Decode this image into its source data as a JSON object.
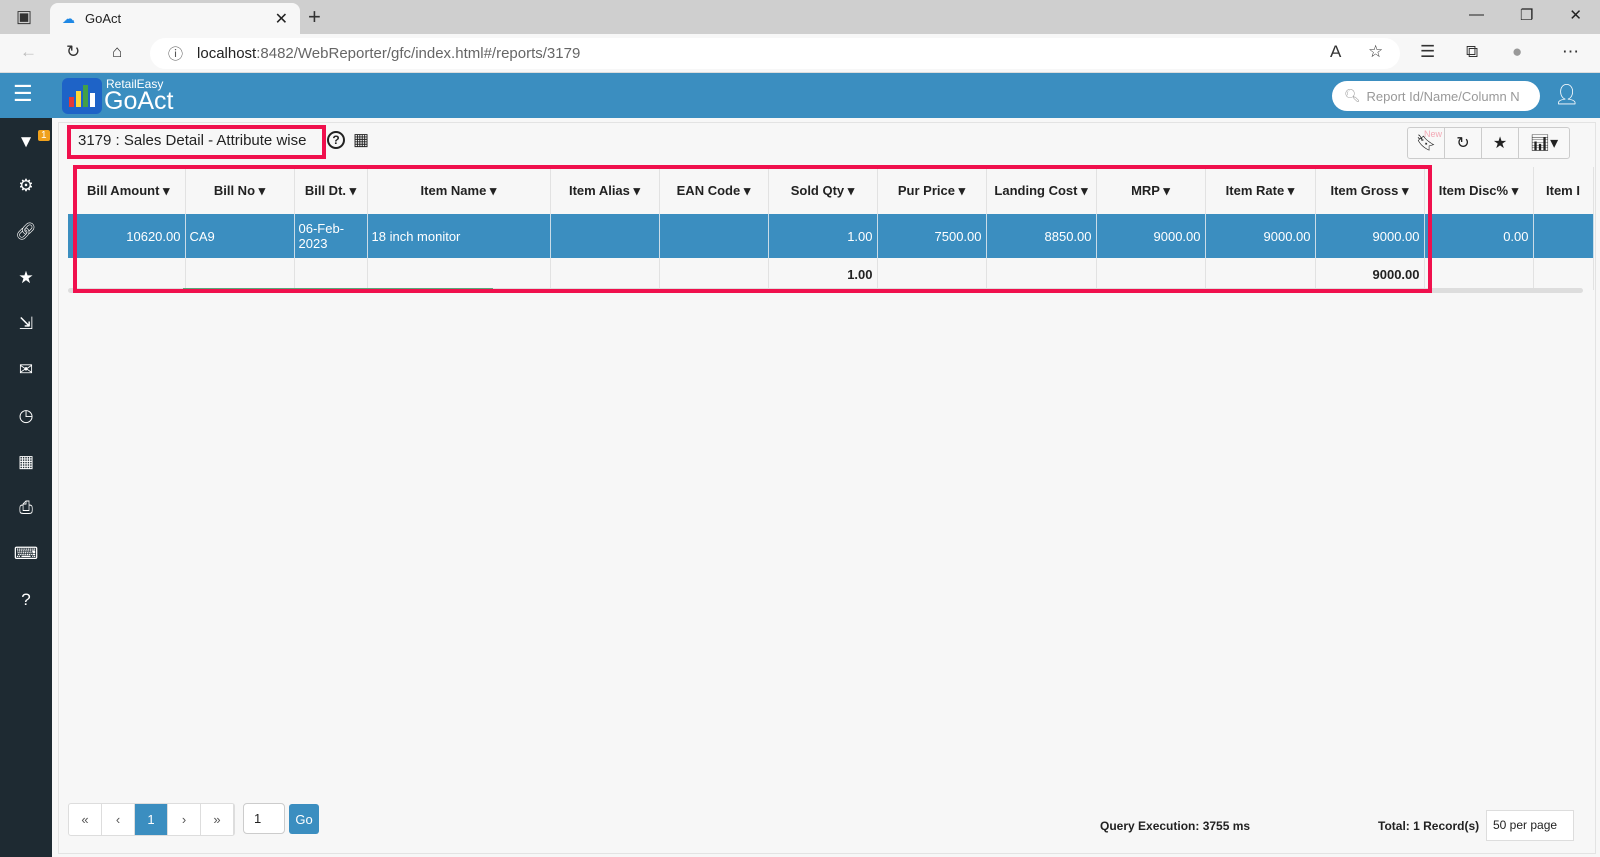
{
  "browser": {
    "tab_title": "GoAct",
    "url_host": "localhost",
    "url_rest": ":8482/WebReporter/gfc/index.html#/reports/3179"
  },
  "app": {
    "brand_top": "RetailEasy",
    "brand_main": "GoAct",
    "search_placeholder": "Report Id/Name/Column N",
    "accent": "#3b8ec0",
    "sidebar_bg": "#1e2a32"
  },
  "sidebar": {
    "filter_badge": "1",
    "icons": [
      "filter-icon",
      "gear-icon",
      "link-icon",
      "star-icon",
      "export-icon",
      "mail-icon",
      "clock-icon",
      "calendar-icon",
      "print-icon",
      "keyboard-icon",
      "help-icon"
    ]
  },
  "report": {
    "title": "3179 : Sales Detail - Attribute wise",
    "new_label": "New"
  },
  "table": {
    "columns": [
      "Bill Amount",
      "Bill No",
      "Bill Dt.",
      "Item Name",
      "Item Alias",
      "EAN Code",
      "Sold Qty",
      "Pur Price",
      "Landing Cost",
      "MRP",
      "Item Rate",
      "Item Gross",
      "Item Disc%",
      "Item I"
    ],
    "rows": [
      [
        "10620.00",
        "CA9",
        "06-Feb-2023",
        "18 inch monitor",
        "",
        "",
        "1.00",
        "7500.00",
        "8850.00",
        "9000.00",
        "9000.00",
        "9000.00",
        "0.00",
        ""
      ]
    ],
    "totals": [
      "",
      "",
      "",
      "",
      "",
      "",
      "1.00",
      "",
      "",
      "",
      "",
      "9000.00",
      "",
      ""
    ]
  },
  "footer": {
    "first": "«",
    "prev": "‹",
    "page": "1",
    "next": "›",
    "last": "»",
    "goto_value": "1",
    "go": "Go",
    "query": "Query Execution: 3755 ms",
    "total": "Total: 1 Record(s)",
    "per_page": "50 per page"
  }
}
